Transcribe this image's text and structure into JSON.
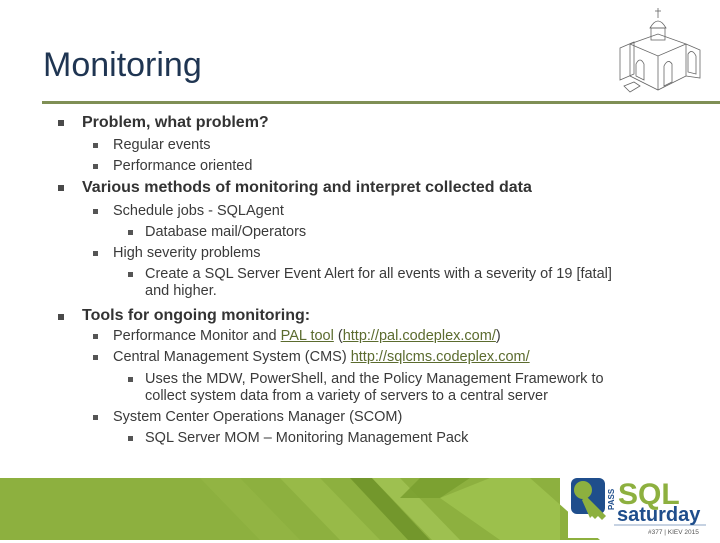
{
  "slide": {
    "title": "Monitoring",
    "bullets": [
      {
        "text": "Problem, what problem?",
        "children": [
          {
            "text": "Regular events"
          },
          {
            "text": "Performance oriented"
          }
        ]
      },
      {
        "text": "Various methods of monitoring and interpret collected data",
        "children": [
          {
            "text": "Schedule jobs - SQLAgent",
            "children": [
              {
                "text": "Database mail/Operators"
              }
            ]
          },
          {
            "text": "High severity problems",
            "children": [
              {
                "text_line1": "Create a SQL Server Event Alert for all events with a severity of 19 [fatal]",
                "text_line2": "and higher."
              }
            ]
          }
        ]
      },
      {
        "text": "Tools for ongoing monitoring:",
        "children": [
          {
            "prefix": "Performance Monitor and ",
            "link1": "PAL tool",
            "mid": " (",
            "link2": "http://pal.codeplex.com/",
            "suffix": ")"
          },
          {
            "prefix": "Central Management System (CMS) ",
            "link": "http://sqlcms.codeplex.com/",
            "children": [
              {
                "text_line1": "Uses the MDW, PowerShell, and the Policy Management Framework to",
                "text_line2": "collect system data from a variety of servers to a central server"
              }
            ]
          },
          {
            "text": "System Center Operations Manager (SCOM)",
            "children": [
              {
                "text": "SQL Server MOM – Monitoring Management Pack"
              }
            ]
          }
        ]
      }
    ]
  },
  "logo": {
    "pass": "PASS",
    "sql": "SQL",
    "saturday": "saturday",
    "event": "#377 | KIEV 2015"
  },
  "colors": {
    "title": "#1f3552",
    "rule": "#7f8f55",
    "footer_green": "#8db03f",
    "link": "#5b6b2e",
    "logo_blue": "#1f4e8c",
    "logo_green": "#8db03f"
  }
}
